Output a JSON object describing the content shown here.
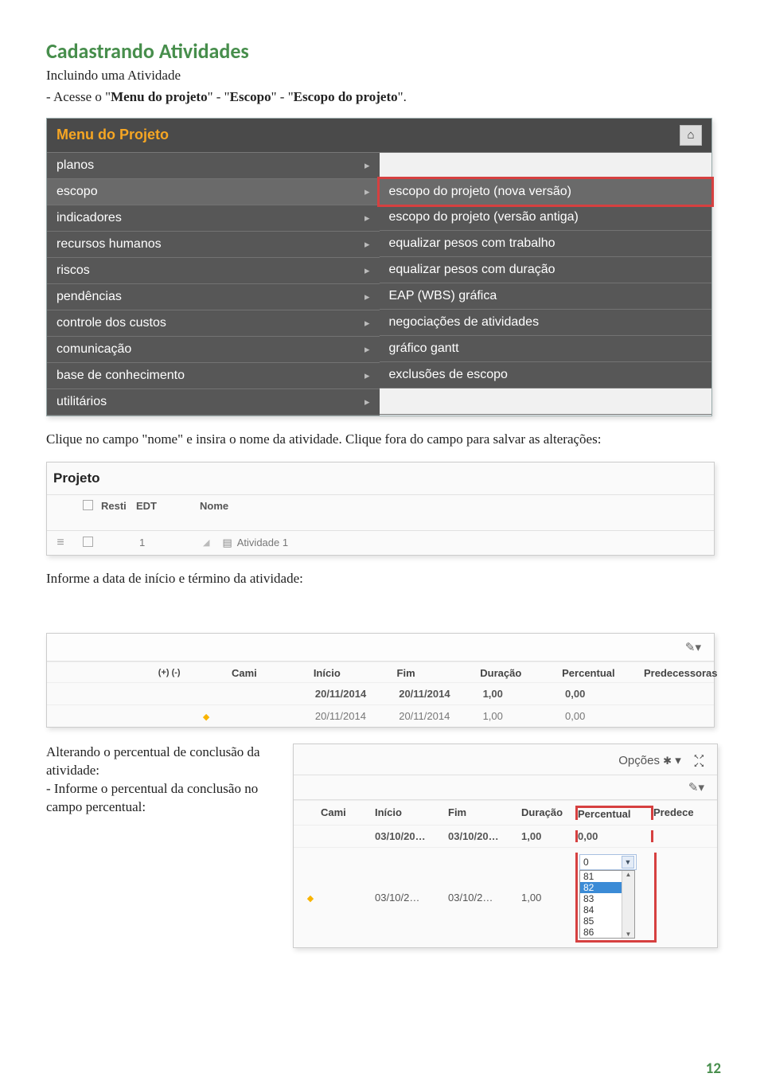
{
  "title": "Cadastrando Atividades",
  "intro_line1": "Incluindo uma Atividade",
  "intro_line2_pre": "- Acesse o \"",
  "intro_line2_bold": "Menu do projeto",
  "intro_line2_mid": "\" - \"",
  "intro_line2_esc1": "Escopo",
  "intro_line2_mid2": "\" - \"",
  "intro_line2_esc2": "Escopo do projeto",
  "intro_line2_end": "\".",
  "menu": {
    "header": "Menu do Projeto",
    "left": [
      "planos",
      "escopo",
      "indicadores",
      "recursos humanos",
      "riscos",
      "pendências",
      "controle dos custos",
      "comunicação",
      "base de conhecimento",
      "utilitários"
    ],
    "right": [
      "escopo do projeto (nova versão)",
      "escopo do projeto (versão antiga)",
      "equalizar pesos com trabalho",
      "equalizar pesos com duração",
      "EAP (WBS) gráfica",
      "negociações de atividades",
      "gráfico gantt",
      "exclusões de escopo"
    ]
  },
  "para1": "Clique no campo \"nome\" e insira o nome da atividade. Clique fora do campo para salvar as alterações:",
  "projeto": {
    "title": "Projeto",
    "cols": {
      "resti": "Resti",
      "edt": "EDT",
      "nome": "Nome"
    },
    "row": {
      "edt": "1",
      "nome": "Atividade 1"
    }
  },
  "para2": "Informe a data de início e término da atividade:",
  "dates": {
    "plusminus": "(+) (-)",
    "cols": {
      "cami": "Cami",
      "inicio": "Início",
      "fim": "Fim",
      "duracao": "Duração",
      "percentual": "Percentual",
      "pred": "Predecessoras"
    },
    "row1": {
      "inicio": "20/11/2014",
      "fim": "20/11/2014",
      "duracao": "1,00",
      "percentual": "0,00"
    },
    "row2": {
      "inicio": "20/11/2014",
      "fim": "20/11/2014",
      "duracao": "1,00",
      "percentual": "0,00"
    }
  },
  "percent_text": {
    "l1": "Alterando o percentual de conclusão da atividade:",
    "l2": "- Informe o percentual da conclusão no campo percentual:"
  },
  "percent": {
    "opcoes": "Opções",
    "cols": {
      "cami": "Cami",
      "inicio": "Início",
      "fim": "Fim",
      "duracao": "Duração",
      "percentual": "Percentual",
      "pred": "Predece"
    },
    "row1": {
      "inicio": "03/10/20…",
      "fim": "03/10/20…",
      "duracao": "1,00",
      "percentual": "0,00"
    },
    "row2": {
      "inicio": "03/10/2…",
      "fim": "03/10/2…",
      "duracao": "1,00"
    },
    "select_value": "0",
    "options": [
      "81",
      "82",
      "83",
      "84",
      "85",
      "86"
    ]
  },
  "page_number": "12"
}
